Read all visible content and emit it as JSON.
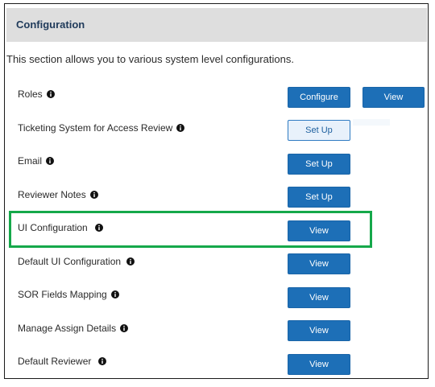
{
  "header": {
    "title": "Configuration"
  },
  "intro": {
    "text": "This section allows you to various system level configurations."
  },
  "rows": [
    {
      "label": "Roles",
      "buttons": [
        "Configure",
        "View"
      ]
    },
    {
      "label": "Ticketing System for Access Review",
      "buttons": [
        "Set Up"
      ]
    },
    {
      "label": "Email",
      "buttons": [
        "Set Up"
      ]
    },
    {
      "label": "Reviewer Notes",
      "buttons": [
        "Set Up"
      ]
    },
    {
      "label": "UI Configuration",
      "buttons": [
        "View"
      ]
    },
    {
      "label": "Default UI Configuration",
      "buttons": [
        "View"
      ]
    },
    {
      "label": "SOR Fields Mapping",
      "buttons": [
        "View"
      ]
    },
    {
      "label": "Manage Assign Details",
      "buttons": [
        "View"
      ]
    },
    {
      "label": "Default Reviewer",
      "buttons": [
        "View"
      ]
    }
  ],
  "colors": {
    "button": "#1d6fb7",
    "highlight": "#15a84a",
    "header_bg": "#dedede"
  },
  "icons": {
    "info": "info-circle-icon"
  }
}
